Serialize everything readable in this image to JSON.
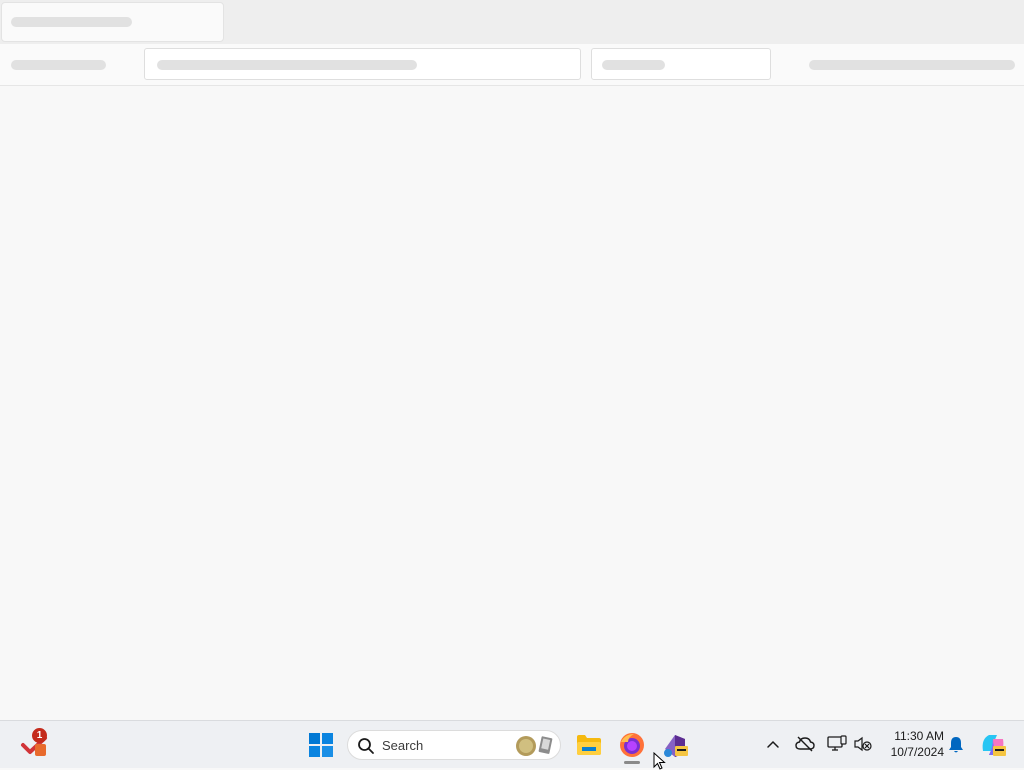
{
  "taskbar": {
    "todo_badge_count": "1",
    "search_label": "Search",
    "clock_time": "11:30 AM",
    "clock_date": "10/7/2024",
    "pinned_apps": [
      "todo-icon",
      "windows-start-icon",
      "file-explorer-icon",
      "firefox-icon",
      "visual-studio-preview-icon"
    ],
    "tray_icons": [
      "chevron-up-icon",
      "onedrive-offline-icon",
      "network-icon",
      "volume-muted-icon",
      "notification-bell-icon",
      "copilot-icon"
    ]
  },
  "colors": {
    "taskbar_bg": "#eef0f3",
    "page_bg": "#f8f8f8",
    "skeleton": "#e1e1e1",
    "windows_blue": "#0078d4"
  }
}
